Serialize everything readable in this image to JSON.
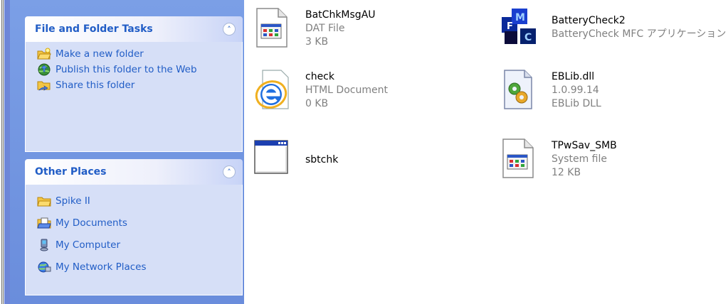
{
  "task_pane": {
    "file_folder_tasks": {
      "title": "File and Folder Tasks",
      "items": [
        {
          "label": "Make a new folder",
          "icon": "new-folder-icon"
        },
        {
          "label": "Publish this folder to the Web",
          "icon": "publish-web-icon"
        },
        {
          "label": "Share this folder",
          "icon": "share-folder-icon"
        }
      ]
    },
    "other_places": {
      "title": "Other Places",
      "items": [
        {
          "label": "Spike II",
          "icon": "folder-icon"
        },
        {
          "label": "My Documents",
          "icon": "my-documents-icon"
        },
        {
          "label": "My Computer",
          "icon": "my-computer-icon"
        },
        {
          "label": "My Network Places",
          "icon": "network-places-icon"
        }
      ]
    }
  },
  "files": [
    {
      "name": "BatChkMsgAU",
      "line2": "DAT File",
      "line3": "3 KB",
      "icon": "dat-file-icon"
    },
    {
      "name": "BatteryCheck2",
      "line2": "BatteryCheck MFC アプリケーション",
      "line3": "",
      "icon": "mfc-app-icon"
    },
    {
      "name": "check",
      "line2": "HTML Document",
      "line3": "0 KB",
      "icon": "ie-html-icon"
    },
    {
      "name": "EBLib.dll",
      "line2": "1.0.99.14",
      "line3": "EBLib DLL",
      "icon": "dll-file-icon"
    },
    {
      "name": "sbtchk",
      "line2": "",
      "line3": "",
      "icon": "application-window-icon"
    },
    {
      "name": "TPwSav_SMB",
      "line2": "System file",
      "line3": "12 KB",
      "icon": "system-file-icon"
    }
  ],
  "colors": {
    "task_link": "#215dc6",
    "panel_body": "#d6dff7",
    "pane_background": "#7b9fe6",
    "file_detail_text": "#808080"
  }
}
